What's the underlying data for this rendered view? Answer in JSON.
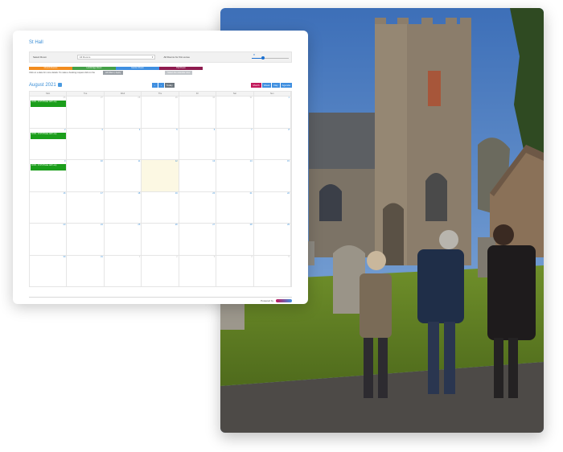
{
  "hall_title": "St Hall",
  "filter": {
    "select_room_label": "Select Room",
    "room_select_value": "All Rooms",
    "rooms_response_label": "All Rooms for this venue",
    "slider_value": "8",
    "slider_fraction": 0.3
  },
  "legend": [
    {
      "label": "Church Rooms",
      "color": "#f28c1e"
    },
    {
      "label": "Lambridge Room",
      "color": "#43a047"
    },
    {
      "label": "Garden Room",
      "color": "#3f8fe0"
    },
    {
      "label": "Hall Room",
      "color": "#8e1b4f"
    }
  ],
  "note_text": "Click on a date for more details. To make a booking request click on the",
  "filter_button": "All Filters | Apply",
  "show_button": "Select the calendar view",
  "toolbar": {
    "month_title": "August 2021",
    "prev": "‹",
    "next": "›",
    "today": "Today",
    "views": [
      "Month",
      "Week",
      "Day",
      "Agenda"
    ]
  },
  "weekdays": [
    "Mon",
    "Tue",
    "Wed",
    "Thu",
    "Fri",
    "Sat",
    "Sun"
  ],
  "weeks": [
    {
      "days": [
        "26",
        "27",
        "28",
        "29",
        "30",
        "31",
        "1"
      ],
      "other": [
        true,
        true,
        true,
        true,
        true,
        true,
        false
      ],
      "event": "10:00 - 13:15 Private with Lucy"
    },
    {
      "days": [
        "2",
        "3",
        "4",
        "5",
        "6",
        "7",
        "8"
      ],
      "other": [
        false,
        false,
        false,
        false,
        false,
        false,
        false
      ],
      "event": "10:00 - 13:15 Private with Lucy"
    },
    {
      "days": [
        "9",
        "10",
        "11",
        "12",
        "13",
        "14",
        "15"
      ],
      "other": [
        false,
        false,
        false,
        false,
        false,
        false,
        false
      ],
      "event": "10:00 - 13:15 Private with Lucy",
      "today_index": 3
    },
    {
      "days": [
        "16",
        "17",
        "18",
        "19",
        "20",
        "21",
        "22"
      ],
      "other": [
        false,
        false,
        false,
        false,
        false,
        false,
        false
      ]
    },
    {
      "days": [
        "23",
        "24",
        "25",
        "26",
        "27",
        "28",
        "29"
      ],
      "other": [
        false,
        false,
        false,
        false,
        false,
        false,
        false
      ]
    },
    {
      "days": [
        "30",
        "31",
        "1",
        "2",
        "3",
        "4",
        "5"
      ],
      "other": [
        false,
        false,
        true,
        true,
        true,
        true,
        true
      ]
    }
  ],
  "powered_by": "Powered by"
}
